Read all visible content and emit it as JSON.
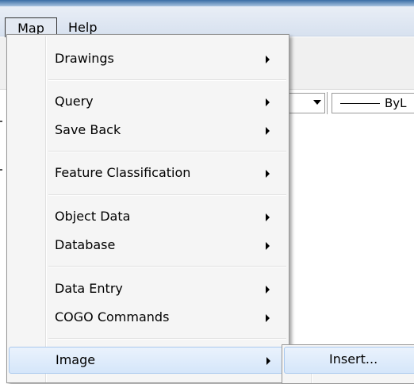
{
  "menubar": {
    "items": [
      {
        "label": "Map"
      },
      {
        "label": "Help"
      }
    ]
  },
  "toolbar": {
    "linetype_label": "ByL"
  },
  "map_menu": {
    "items": [
      {
        "label": "Drawings",
        "has_submenu": true
      },
      {
        "label": "Query",
        "has_submenu": true
      },
      {
        "label": "Save Back",
        "has_submenu": true
      },
      {
        "label": "Feature Classification",
        "has_submenu": true
      },
      {
        "label": "Object Data",
        "has_submenu": true
      },
      {
        "label": "Database",
        "has_submenu": true
      },
      {
        "label": "Data Entry",
        "has_submenu": true
      },
      {
        "label": "COGO Commands",
        "has_submenu": true
      },
      {
        "label": "Image",
        "has_submenu": true
      }
    ]
  },
  "image_submenu": {
    "items": [
      {
        "label": "Insert..."
      }
    ]
  },
  "colors": {
    "highlight_top": "#eaf2fc",
    "highlight_bottom": "#d5e6fa",
    "highlight_border": "#a8c8ee",
    "menu_background": "#f5f5f5"
  }
}
